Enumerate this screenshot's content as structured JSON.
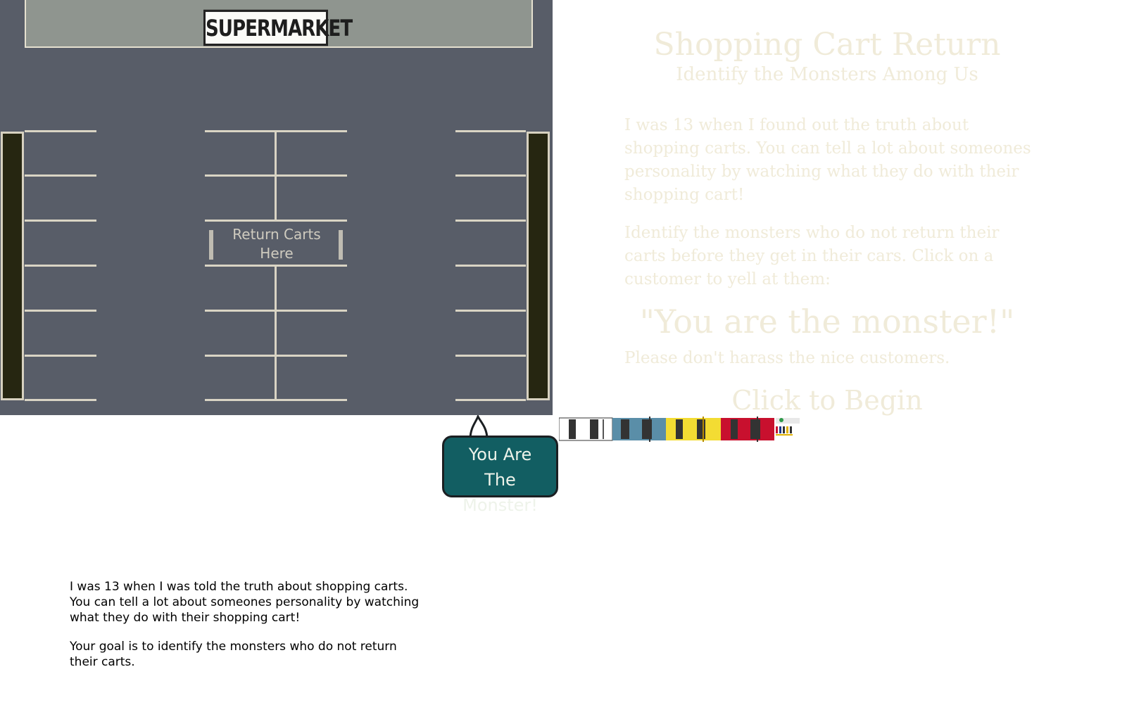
{
  "lot": {
    "store_sign": "SUPERMARKET",
    "corral_label_line1": "Return Carts",
    "corral_label_line2": "Here"
  },
  "bubble": {
    "line1": "You Are",
    "line2": "The Monster!"
  },
  "title_panel": {
    "title": "Shopping Cart Return",
    "subtitle": "Identify the Monsters Among Us",
    "intro_1": "I was 13 when I found out the truth about shopping carts. You can tell a lot about someones personality by watching what they do with their shopping cart!",
    "intro_2": "Identify the monsters who do not return their carts before they get in their cars. Click on a customer to yell at them:",
    "quote": "\"You are the monster!\"",
    "note": "Please don't harass the nice customers.",
    "begin": "Click to Begin"
  },
  "instructions": {
    "line1": "I was 13 when I was told the truth about shopping carts.",
    "line2": "You can tell a lot about someones personality by watching",
    "line3": "what they do with their shopping cart!",
    "goal_line1": "Your goal is to identify the monsters who do not return",
    "goal_line2": "their carts."
  },
  "colors": {
    "asphalt": "#585d68",
    "hedge": "#262611",
    "bubble": "#125e62",
    "car_white": "#ffffff",
    "car_blue": "#5a8ea8",
    "car_yellow": "#f3dc33",
    "car_red": "#c8102e"
  }
}
